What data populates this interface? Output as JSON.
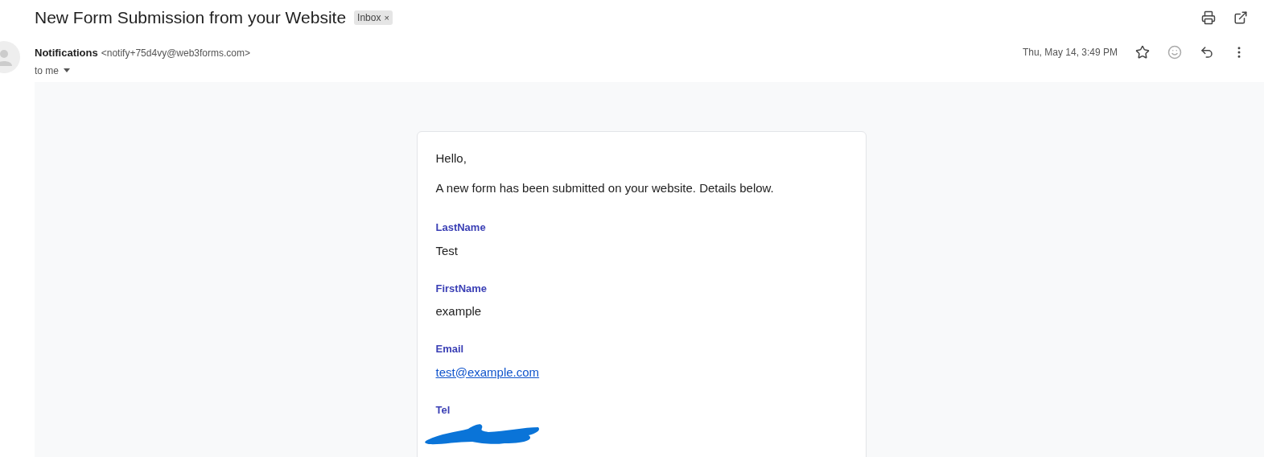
{
  "subject": "New Form Submission from your Website",
  "label_chip": {
    "text": "Inbox",
    "close": "×"
  },
  "sender": {
    "name": "Notifications",
    "address": "<notify+75d4vy@web3forms.com>",
    "recipient": "to me"
  },
  "date": "Thu, May 14, 3:49 PM",
  "body": {
    "greeting": "Hello,",
    "intro": "A new form has been submitted on your website. Details below.",
    "fields": [
      {
        "label": "LastName",
        "kind": "text",
        "value": "Test"
      },
      {
        "label": "FirstName",
        "kind": "text",
        "value": "example"
      },
      {
        "label": "Email",
        "kind": "link",
        "value": "test@example.com"
      },
      {
        "label": "Tel",
        "kind": "redacted"
      }
    ]
  }
}
